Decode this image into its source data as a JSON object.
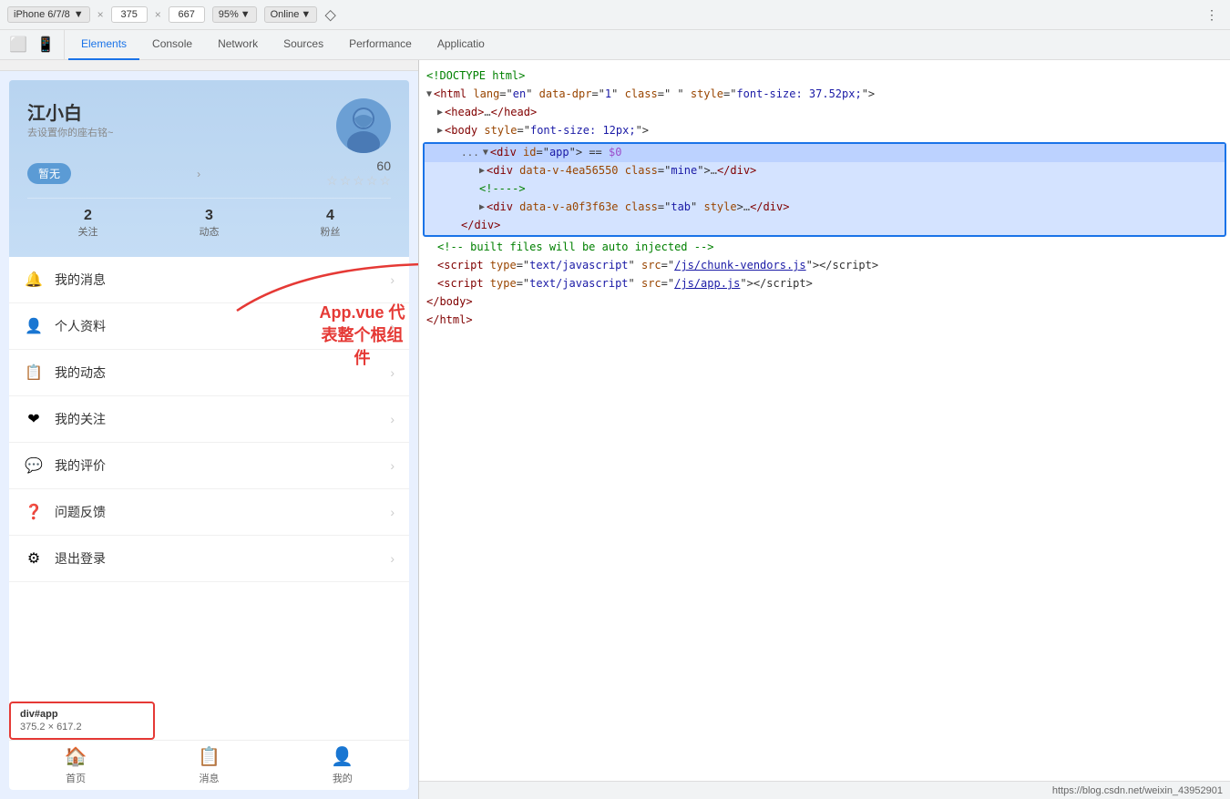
{
  "toolbar": {
    "device": "iPhone 6/7/8",
    "width": "375",
    "height": "667",
    "zoom": "95%",
    "network": "Online",
    "more_icon": "⋮"
  },
  "devtools_tabs": [
    {
      "label": "Elements",
      "active": true
    },
    {
      "label": "Console",
      "active": false
    },
    {
      "label": "Network",
      "active": false
    },
    {
      "label": "Sources",
      "active": false
    },
    {
      "label": "Performance",
      "active": false
    },
    {
      "label": "Applicatio",
      "active": false
    }
  ],
  "profile": {
    "name": "江小白",
    "bio": "去设置你的座右铭~",
    "tag": "暂无",
    "stars_count": "60",
    "stats": [
      {
        "number": "2",
        "label": "关注"
      },
      {
        "number": "3",
        "label": "动态"
      },
      {
        "number": "4",
        "label": "粉丝"
      }
    ]
  },
  "menu_items": [
    {
      "icon": "🔔",
      "label": "我的消息"
    },
    {
      "icon": "👤",
      "label": "个人资料"
    },
    {
      "icon": "📋",
      "label": "我的动态"
    },
    {
      "icon": "❤",
      "label": "我的关注"
    },
    {
      "icon": "💬",
      "label": "我的评价"
    },
    {
      "icon": "❓",
      "label": "问题反馈"
    },
    {
      "icon": "⚙",
      "label": "退出登录"
    }
  ],
  "bottom_nav": [
    {
      "icon": "🏠",
      "label": "首页"
    },
    {
      "icon": "📋",
      "label": "消息"
    },
    {
      "icon": "👤",
      "label": "我的"
    }
  ],
  "element_info": {
    "tag": "div#app",
    "size": "375.2 × 617.2"
  },
  "annotation": "App.vue 代表整个根组件",
  "code": {
    "lines": [
      {
        "indent": 0,
        "text": "<!DOCTYPE html>",
        "type": "comment"
      },
      {
        "indent": 0,
        "triangle": "down",
        "text": "<html lang=\"en\" data-dpr=\"1\" class=\" \" style=\"font-size: 37.52px;\">",
        "type": "tag"
      },
      {
        "indent": 1,
        "triangle": "right",
        "text": "<head>…</head>",
        "type": "tag"
      },
      {
        "indent": 1,
        "triangle": "right",
        "text": "<body style=\"font-size: 12px;\">",
        "type": "tag"
      },
      {
        "indent": 2,
        "dots": "...",
        "triangle": "down",
        "text": "<div id=\"app\"> == $0",
        "type": "selected"
      },
      {
        "indent": 3,
        "triangle": "right",
        "text": "<div data-v-4ea56550 class=\"mine\">…</div>",
        "type": "tag"
      },
      {
        "indent": 3,
        "text": "<!---->",
        "type": "comment"
      },
      {
        "indent": 3,
        "triangle": "right",
        "text": "<div data-v-a0f3f63e class=\"tab\" style>…</div>",
        "type": "tag"
      },
      {
        "indent": 2,
        "text": "</div>",
        "type": "tag"
      },
      {
        "indent": 1,
        "text": "<!-- built files will be auto injected -->",
        "type": "comment"
      },
      {
        "indent": 1,
        "text": "<script type=\"text/javascript\" src=\"/js/chunk-vendors.js\"><\\/script>",
        "type": "script"
      },
      {
        "indent": 1,
        "text": "<script type=\"text/javascript\" src=\"/js/app.js\"><\\/script>",
        "type": "script"
      },
      {
        "indent": 0,
        "text": "</body>",
        "type": "tag"
      },
      {
        "indent": 0,
        "text": "</html>",
        "type": "tag"
      }
    ]
  },
  "devtools_bottom": {
    "url": "https://blog.csdn.net/weixin_43952901"
  }
}
